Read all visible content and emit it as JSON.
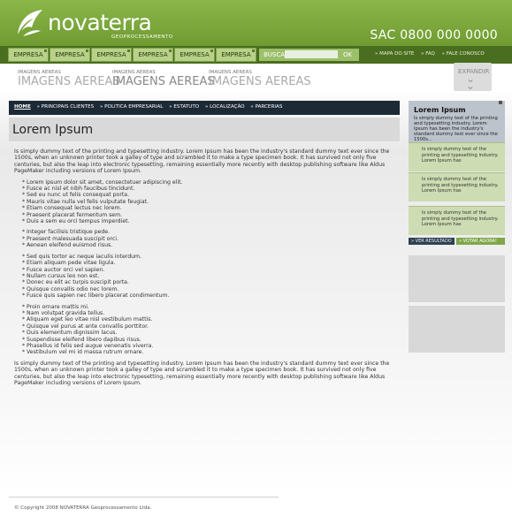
{
  "header": {
    "brand": "novaterra",
    "brand_sub": "GEOPROCESSAMENTO",
    "sac": "SAC 0800 000 0000"
  },
  "topnav": {
    "tabs": [
      "EMPRESA",
      "EMPRESA",
      "EMPRESA",
      "EMPRESA",
      "EMPRESA",
      "EMPRESA"
    ],
    "search_label": "BUSCA",
    "search_value": "",
    "ok_label": "OK",
    "links": [
      "» MAPA DO SITE",
      "» FAQ",
      "» FALE CONOSCO"
    ]
  },
  "images_band": {
    "items": [
      {
        "small": "IMAGENS AEREAS",
        "big": "IMAGENS AEREAS"
      },
      {
        "small": "IMAGENS AEREAS",
        "big": "IMAGENS AEREAS"
      },
      {
        "small": "IMAGENS AEREAS",
        "big": "IMAGENS AEREAS"
      }
    ],
    "expand_label": "EXPANDIR"
  },
  "breadcrumb": [
    "HOME",
    "» PRINCIPAIS CLIENTES",
    "» POLITICA EMPRESARIAL",
    "» ESTATUTO",
    "» LOCALIZAÇÃO",
    "» PARCERIAS"
  ],
  "page_title": "Lorem Ipsum",
  "content": {
    "intro": "Is simply dummy text of the printing and typesetting industry. Lorem Ipsum has been the industry's standard dummy text ever since the 1500s, when an unknown printer took a galley of type and scrambled it to make a type specimen book. It has survived not only five centuries, but also the leap into electronic typesetting, remaining essentially more recently with desktop publishing software like Aldus PageMaker including versions of Lorem Ipsum.",
    "lists": [
      [
        "* Lorem ipsum dolor sit amet, consectetuer adipiscing elit.",
        "* Fusce ac nisl et nibh faucibus tincidunt.",
        "* Sed eu nunc ut felis consequat porta.",
        "* Mauris vitae nulla vel felis vulputate feugiat.",
        "* Etiam consequat lectus nec lorem.",
        "* Praesent placerat fermentum sem.",
        "* Duis a sem eu orci tempus imperdiet."
      ],
      [
        "* Integer facilisis tristique pede.",
        "* Praesent malesuada suscipit orci.",
        "* Aenean eleifend euismod risus."
      ],
      [
        "* Sed quis tortor ac neque iaculis interdum.",
        "* Etiam aliquam pede vitae ligula.",
        "* Fusce auctor orci vel sapien.",
        "* Nullam cursus leo non est.",
        "* Donec eu elit ac turpis suscipit porta.",
        "* Quisque convallis odio nec lorem.",
        "* Fusce quis sapien nec libero placerat condimentum."
      ],
      [
        "* Proin ornare mattis mi.",
        "* Nam volutpat gravida tellus.",
        "* Aliquam eget leo vitae nisl vestibulum mattis.",
        "* Quisque vel purus at ante convallis porttitor.",
        "* Duis elementum dignissim lacus.",
        "* Suspendisse eleifend libero dapibus risus.",
        "* Phasellus id felis sed augue venenatis viverra.",
        "* Vestibulum vel mi id massa rutrum ornare."
      ]
    ],
    "outro": "Is simply dummy text of the printing and typesetting industry. Lorem Ipsum has been the industry's standard dummy text ever since the 1500s, when an unknown printer took a galley of type and scrambled it to make a type specimen book. It has survived not only five centuries, but also the leap into electronic typesetting, remaining essentially more recently with desktop publishing software like Aldus PageMaker including versions of Lorem Ipsum."
  },
  "sidebar": {
    "title": "Lorem Ipsum",
    "desc": "Is simply dummy text of the printing and typesetting industry. Lorem Ipsum has been the industry's standard dummy text ever since the 1500s...",
    "items": [
      "Is simply dummy text of the printing and typesetting industry. Lorem Ipsum has",
      "Is simply dummy text of the printing and typesetting industry. Lorem Ipsum has",
      "Is simply dummy text of the printing and typesetting industry. Lorem Ipsum has"
    ],
    "btn_results": "» VER RESULTADO",
    "btn_vote": "» VOTAR AGORA!"
  },
  "footer": {
    "copyright": "© Copyright 2008 NOVATERRA Geoprocessamento Ltda."
  },
  "colors": {
    "brand_green": "#7aa83c",
    "dark_nav": "#1d2935"
  }
}
